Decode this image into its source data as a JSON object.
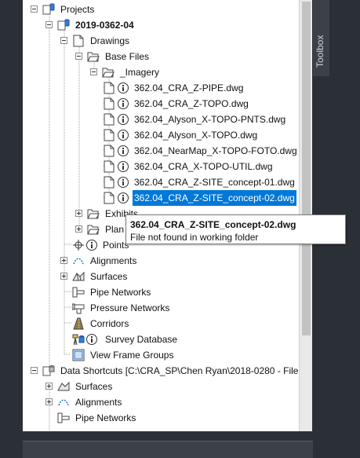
{
  "tree": {
    "projects_label": "Projects",
    "project_name": "2019-0362-04",
    "drawings_label": "Drawings",
    "base_files_label": "Base Files",
    "imagery_label": "_Imagery",
    "files": [
      "362.04_CRA_Z-PIPE.dwg",
      "362.04_CRA_Z-TOPO.dwg",
      "362.04_Alyson_X-TOPO-PNTS.dwg",
      "362.04_Alyson_X-TOPO.dwg",
      "362.04_NearMap_X-TOPO-FOTO.dwg",
      "362.04_CRA_X-TOPO-UTIL.dwg",
      "362.04_CRA_Z-SITE_concept-01.dwg",
      "362.04_CRA_Z-SITE_concept-02.dwg"
    ],
    "exhibits_label": "Exhibits",
    "plans_label": "Plan",
    "points_label": "Points",
    "alignments_label": "Alignments",
    "surfaces_label": "Surfaces",
    "pipe_networks_label": "Pipe Networks",
    "pressure_networks_label": "Pressure Networks",
    "corridors_label": "Corridors",
    "survey_database_label": "Survey Database",
    "view_frame_groups_label": "View Frame Groups",
    "data_shortcuts_label": "Data Shortcuts [C:\\CRA_SP\\Chen Ryan\\2018-0280 - File...",
    "ds_surfaces_label": "Surfaces",
    "ds_alignments_label": "Alignments",
    "ds_pipe_networks_label": "Pipe Networks"
  },
  "tooltip": {
    "title": "362.04_CRA_Z-SITE_concept-02.dwg",
    "message": "File not found in working folder"
  },
  "toolbox_tab": "Toolbox",
  "colors": {
    "selection": "#0078d7",
    "panel_bg": "#ffffff",
    "chrome_bg": "#2b2f36",
    "tab_bg": "#3b4049"
  }
}
